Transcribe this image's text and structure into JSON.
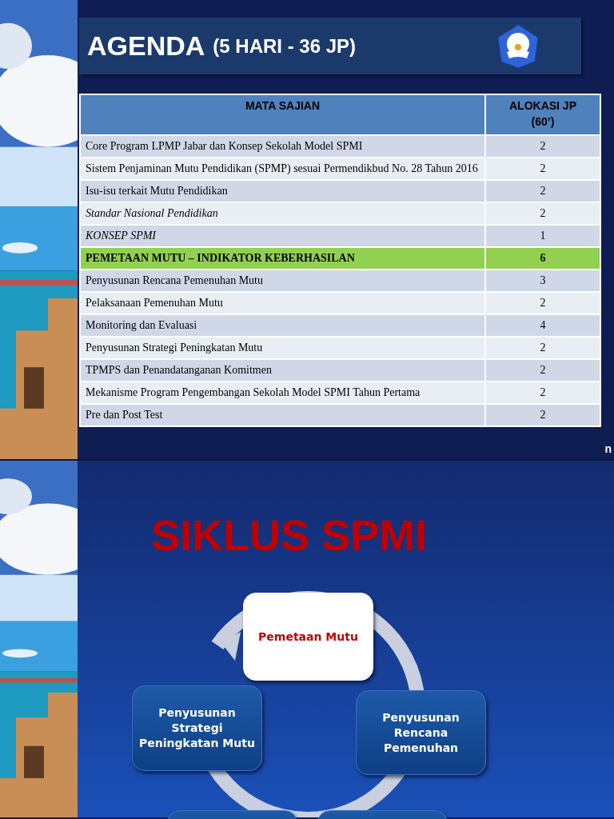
{
  "agenda_slide": {
    "title": "AGENDA",
    "subtitle": "(5 HARI - 36 JP)",
    "table": {
      "columns": [
        {
          "lines": [
            "MATA SAJIAN"
          ]
        },
        {
          "lines": [
            "ALOKASI JP",
            "(60’)"
          ]
        }
      ],
      "rows": [
        {
          "topic": "Core Program LPMP Jabar dan Konsep Sekolah Model SPMI",
          "jp": "2",
          "kind": "normal"
        },
        {
          "topic": "Sistem Penjaminan Mutu Pendidikan (SPMP) sesuai Permendikbud No. 28 Tahun 2016",
          "jp": "2",
          "kind": "normal"
        },
        {
          "topic": "Isu-isu terkait Mutu Pendidikan",
          "jp": "2",
          "kind": "normal"
        },
        {
          "topic": "Standar Nasional Pendidikan",
          "jp": "2",
          "kind": "italic"
        },
        {
          "topic": "KONSEP SPMI",
          "jp": "1",
          "kind": "italic"
        },
        {
          "topic": "PEMETAAN MUTU – INDIKATOR KEBERHASILAN",
          "jp": "6",
          "kind": "highlight"
        },
        {
          "topic": "Penyusunan Rencana Pemenuhan Mutu",
          "jp": "3",
          "kind": "normal"
        },
        {
          "topic": "Pelaksanaan Pemenuhan Mutu",
          "jp": "2",
          "kind": "normal"
        },
        {
          "topic": "Monitoring dan Evaluasi",
          "jp": "4",
          "kind": "normal"
        },
        {
          "topic": "Penyusunan Strategi Peningkatan Mutu",
          "jp": "2",
          "kind": "normal"
        },
        {
          "topic": "TPMPS dan Penandatanganan Komitmen",
          "jp": "2",
          "kind": "normal"
        },
        {
          "topic": "Mekanisme Program Pengembangan Sekolah Model SPMI Tahun Pertama",
          "jp": "2",
          "kind": "hanging"
        },
        {
          "topic": "Pre dan Post Test",
          "jp": "2",
          "kind": "normal"
        }
      ]
    },
    "edge_text": "n"
  },
  "cycle_slide": {
    "title": "SIKLUS SPMI",
    "steps": [
      {
        "label": "Pemetaan Mutu",
        "selected": true
      },
      {
        "label": "Penyusunan Strategi Peningkatan Mutu",
        "selected": false
      },
      {
        "label": "Penyusunan Rencana Pemenuhan",
        "selected": false
      },
      {
        "selected": false
      },
      {
        "selected": false
      }
    ]
  }
}
